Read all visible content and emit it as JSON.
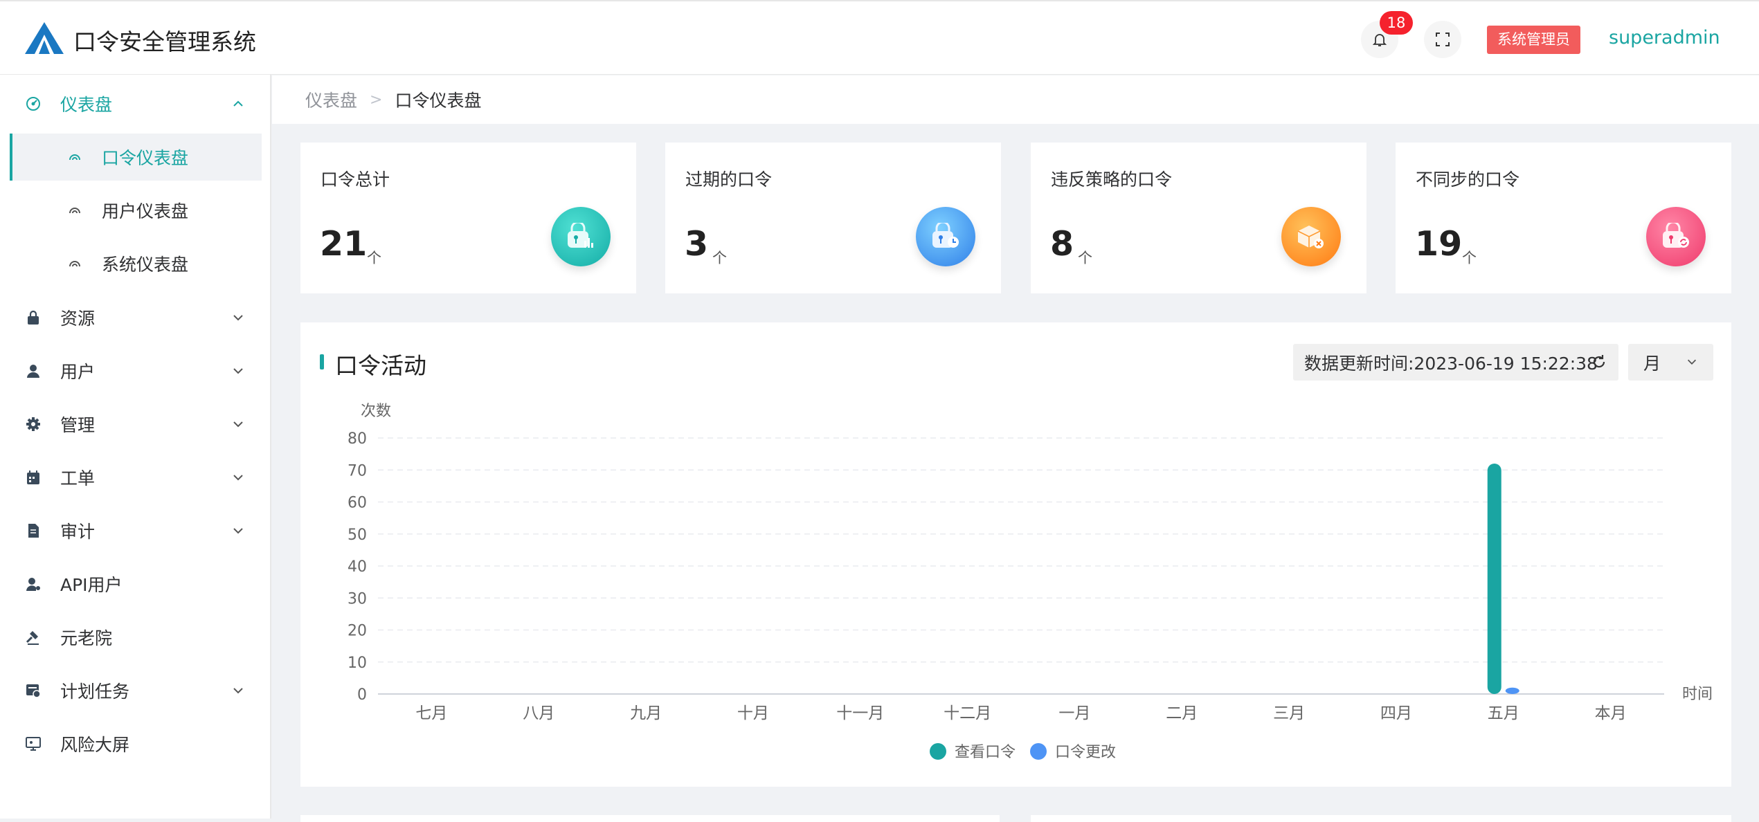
{
  "app": {
    "title": "口令安全管理系统"
  },
  "header": {
    "notification_count": "18",
    "role": "系统管理员",
    "username": "superadmin"
  },
  "sidebar": {
    "items": [
      {
        "label": "仪表盘",
        "icon": "dashboard-icon",
        "expanded": true
      },
      {
        "label": "资源",
        "icon": "lock-icon"
      },
      {
        "label": "用户",
        "icon": "user-icon"
      },
      {
        "label": "管理",
        "icon": "gear-icon"
      },
      {
        "label": "工单",
        "icon": "calendar-icon"
      },
      {
        "label": "审计",
        "icon": "document-icon"
      },
      {
        "label": "API用户",
        "icon": "api-user-icon"
      },
      {
        "label": "元老院",
        "icon": "gavel-icon"
      },
      {
        "label": "计划任务",
        "icon": "schedule-icon"
      },
      {
        "label": "风险大屏",
        "icon": "monitor-icon"
      }
    ],
    "subitems": [
      {
        "label": "口令仪表盘",
        "active": true
      },
      {
        "label": "用户仪表盘"
      },
      {
        "label": "系统仪表盘"
      }
    ]
  },
  "breadcrumb": {
    "parent": "仪表盘",
    "separator": ">",
    "current": "口令仪表盘"
  },
  "stats": [
    {
      "title": "口令总计",
      "value": "21",
      "unit": "个",
      "color": "#1fc0b6"
    },
    {
      "title": "过期的口令",
      "value": "3",
      "unit": "个",
      "color": "#3b8eea"
    },
    {
      "title": "违反策略的口令",
      "value": "8",
      "unit": "个",
      "color": "#ff8a1e"
    },
    {
      "title": "不同步的口令",
      "value": "19",
      "unit": "个",
      "color": "#f2477a"
    }
  ],
  "activity": {
    "title": "口令活动",
    "update_time": "数据更新时间:2023-06-19 15:22:38",
    "period": "月"
  },
  "chart_data": {
    "type": "bar",
    "ylabel": "次数",
    "xlabel": "时间",
    "ylim": [
      0,
      80
    ],
    "yticks": [
      0,
      10,
      20,
      30,
      40,
      50,
      60,
      70,
      80
    ],
    "grid": true,
    "legend_position": "bottom-center",
    "categories": [
      "七月",
      "八月",
      "九月",
      "十月",
      "十一月",
      "十二月",
      "一月",
      "二月",
      "三月",
      "四月",
      "五月",
      "本月"
    ],
    "series": [
      {
        "name": "查看口令",
        "color": "#1aa5a2",
        "values": [
          0,
          0,
          0,
          0,
          0,
          0,
          0,
          0,
          0,
          0,
          72,
          0
        ]
      },
      {
        "name": "口令更改",
        "color": "#4e94f5",
        "values": [
          0,
          0,
          0,
          0,
          0,
          0,
          0,
          0,
          0,
          0,
          2,
          0
        ]
      }
    ]
  }
}
